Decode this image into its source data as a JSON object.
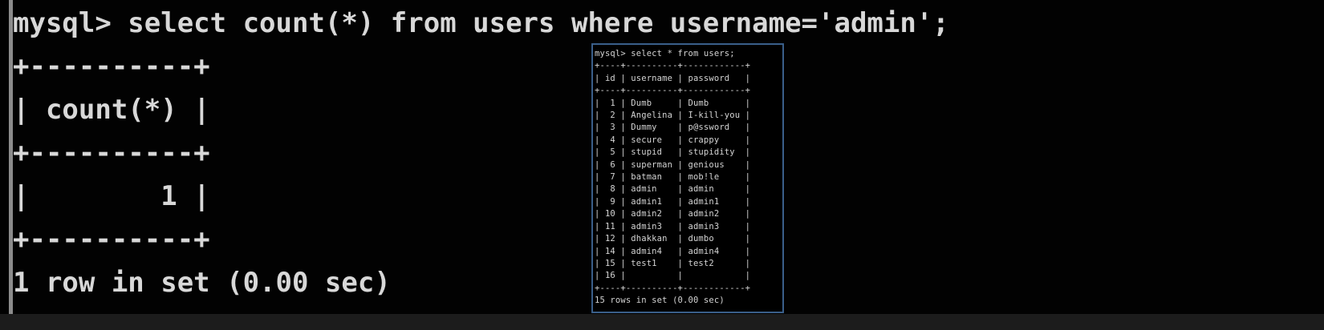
{
  "main_console": {
    "command": "mysql> select count(*) from users where username='admin';",
    "border": "+----------+",
    "header_row": "| count(*) |",
    "value_row": "|        1 |",
    "footer": "1 row in set (0.00 sec)"
  },
  "inset_console": {
    "command": "mysql> select * from users;",
    "border": "+----+----------+------------+",
    "header_row": "| id | username | password   |",
    "rows": [
      "|  1 | Dumb     | Dumb       |",
      "|  2 | Angelina | I-kill-you |",
      "|  3 | Dummy    | p@ssword   |",
      "|  4 | secure   | crappy     |",
      "|  5 | stupid   | stupidity  |",
      "|  6 | superman | genious    |",
      "|  7 | batman   | mob!le     |",
      "|  8 | admin    | admin      |",
      "|  9 | admin1   | admin1     |",
      "| 10 | admin2   | admin2     |",
      "| 11 | admin3   | admin3     |",
      "| 12 | dhakkan  | dumbo      |",
      "| 14 | admin4   | admin4     |",
      "| 15 | test1    | test2      |",
      "| 16 |          |            |"
    ],
    "footer": "15 rows in set (0.00 sec)"
  },
  "colors": {
    "background": "#020202",
    "text": "#d8d8d8",
    "inset_border": "#3a5f8a"
  }
}
